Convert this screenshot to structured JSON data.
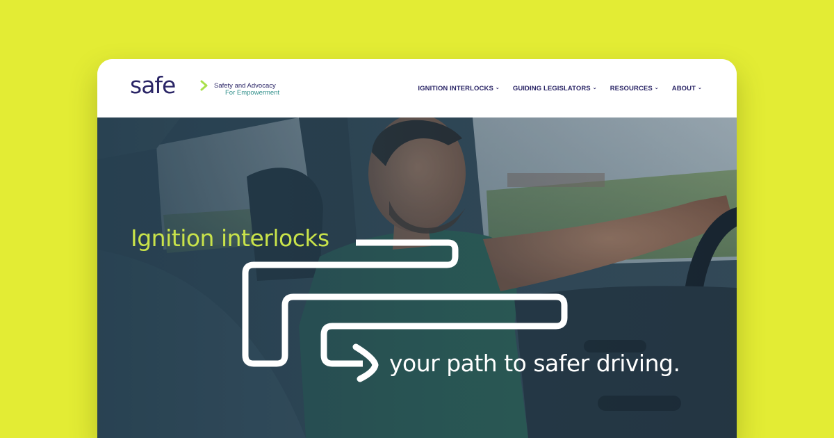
{
  "brand": {
    "logo_text": "safe",
    "tagline_line1": "Safety and Advocacy",
    "tagline_line2": "For Empowerment"
  },
  "nav": {
    "items": [
      {
        "label": "IGNITION INTERLOCKS",
        "icon": "chevron-down-icon"
      },
      {
        "label": "GUIDING LEGISLATORS",
        "icon": "chevron-down-icon"
      },
      {
        "label": "RESOURCES",
        "icon": "chevron-down-icon"
      },
      {
        "label": "ABOUT",
        "icon": "chevron-down-icon"
      }
    ]
  },
  "hero": {
    "heading": "Ignition interlocks",
    "subheading": "your path to safer driving.",
    "image": "man-driving-car-photo"
  },
  "colors": {
    "background": "#e3ec34",
    "brand_navy": "#2a2566",
    "brand_teal": "#2fc6b4",
    "heading_green": "#c9e34a",
    "white": "#ffffff"
  }
}
